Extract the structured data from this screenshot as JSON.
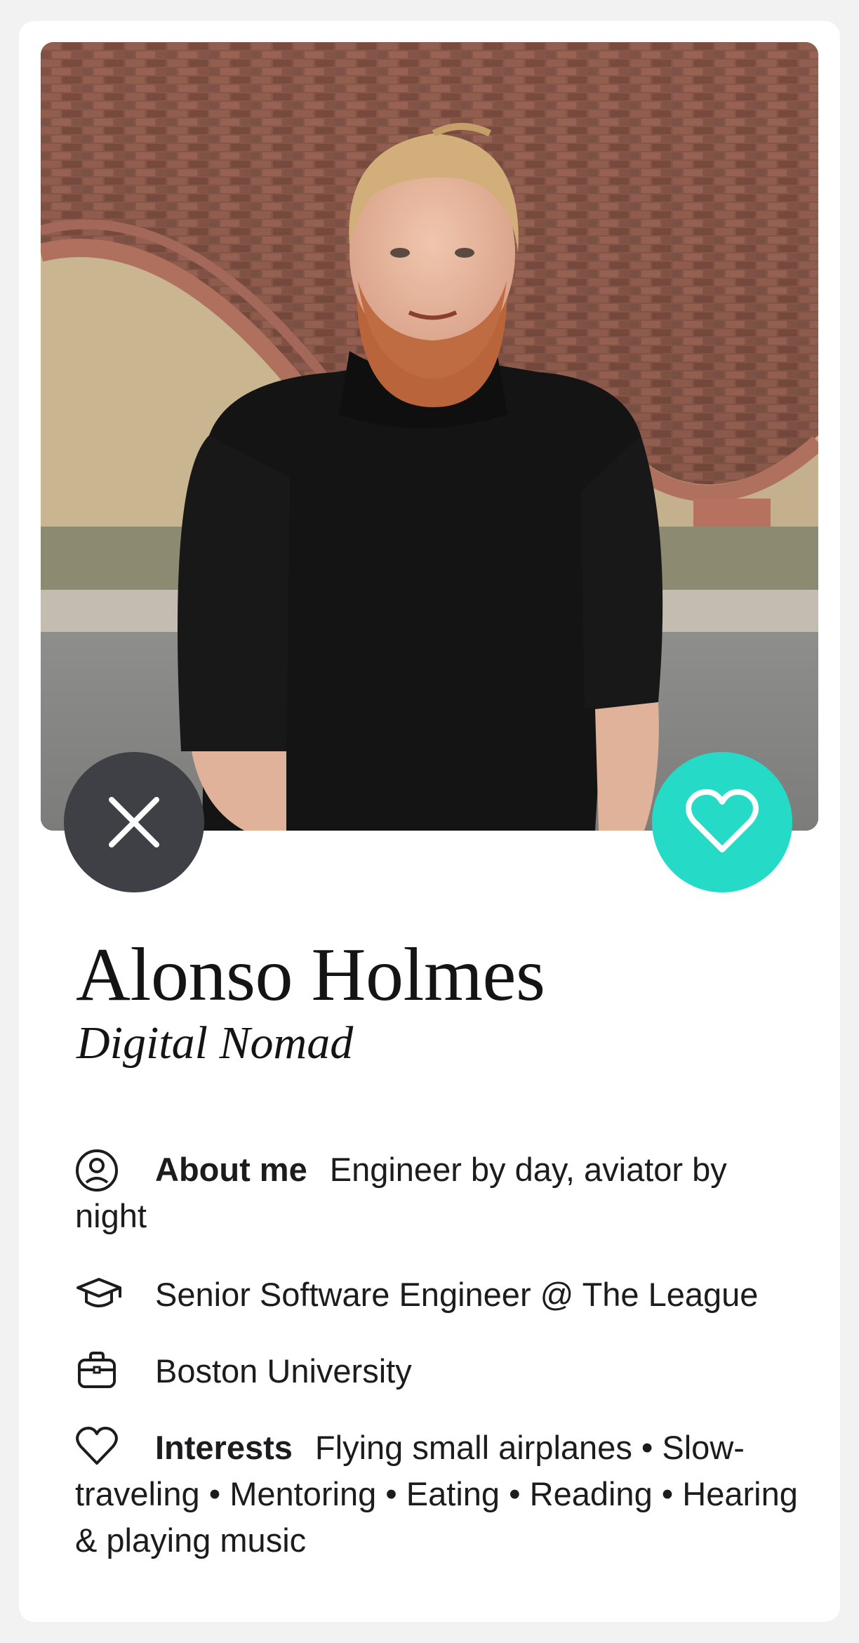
{
  "profile": {
    "name": "Alonso Holmes",
    "tagline": "Digital Nomad",
    "photo_icon": "profile-photo",
    "about": {
      "icon": "user-circle-icon",
      "label": "About me",
      "text": "Engineer by day, aviator by night"
    },
    "job": {
      "icon": "graduation-cap-icon",
      "text": "Senior Software Engineer @ The League"
    },
    "school": {
      "icon": "briefcase-icon",
      "text": "Boston University"
    },
    "interests": {
      "icon": "heart-outline-icon",
      "label": "Interests",
      "text": "Flying small airplanes • Slow-traveling • Mentoring • Eating • Reading • Hearing & playing music"
    }
  },
  "actions": {
    "pass_icon": "close-icon",
    "like_icon": "heart-icon"
  },
  "colors": {
    "pass_button": "#3f4046",
    "like_button": "#25dac6",
    "background": "#f2f2f2",
    "card": "#ffffff"
  }
}
